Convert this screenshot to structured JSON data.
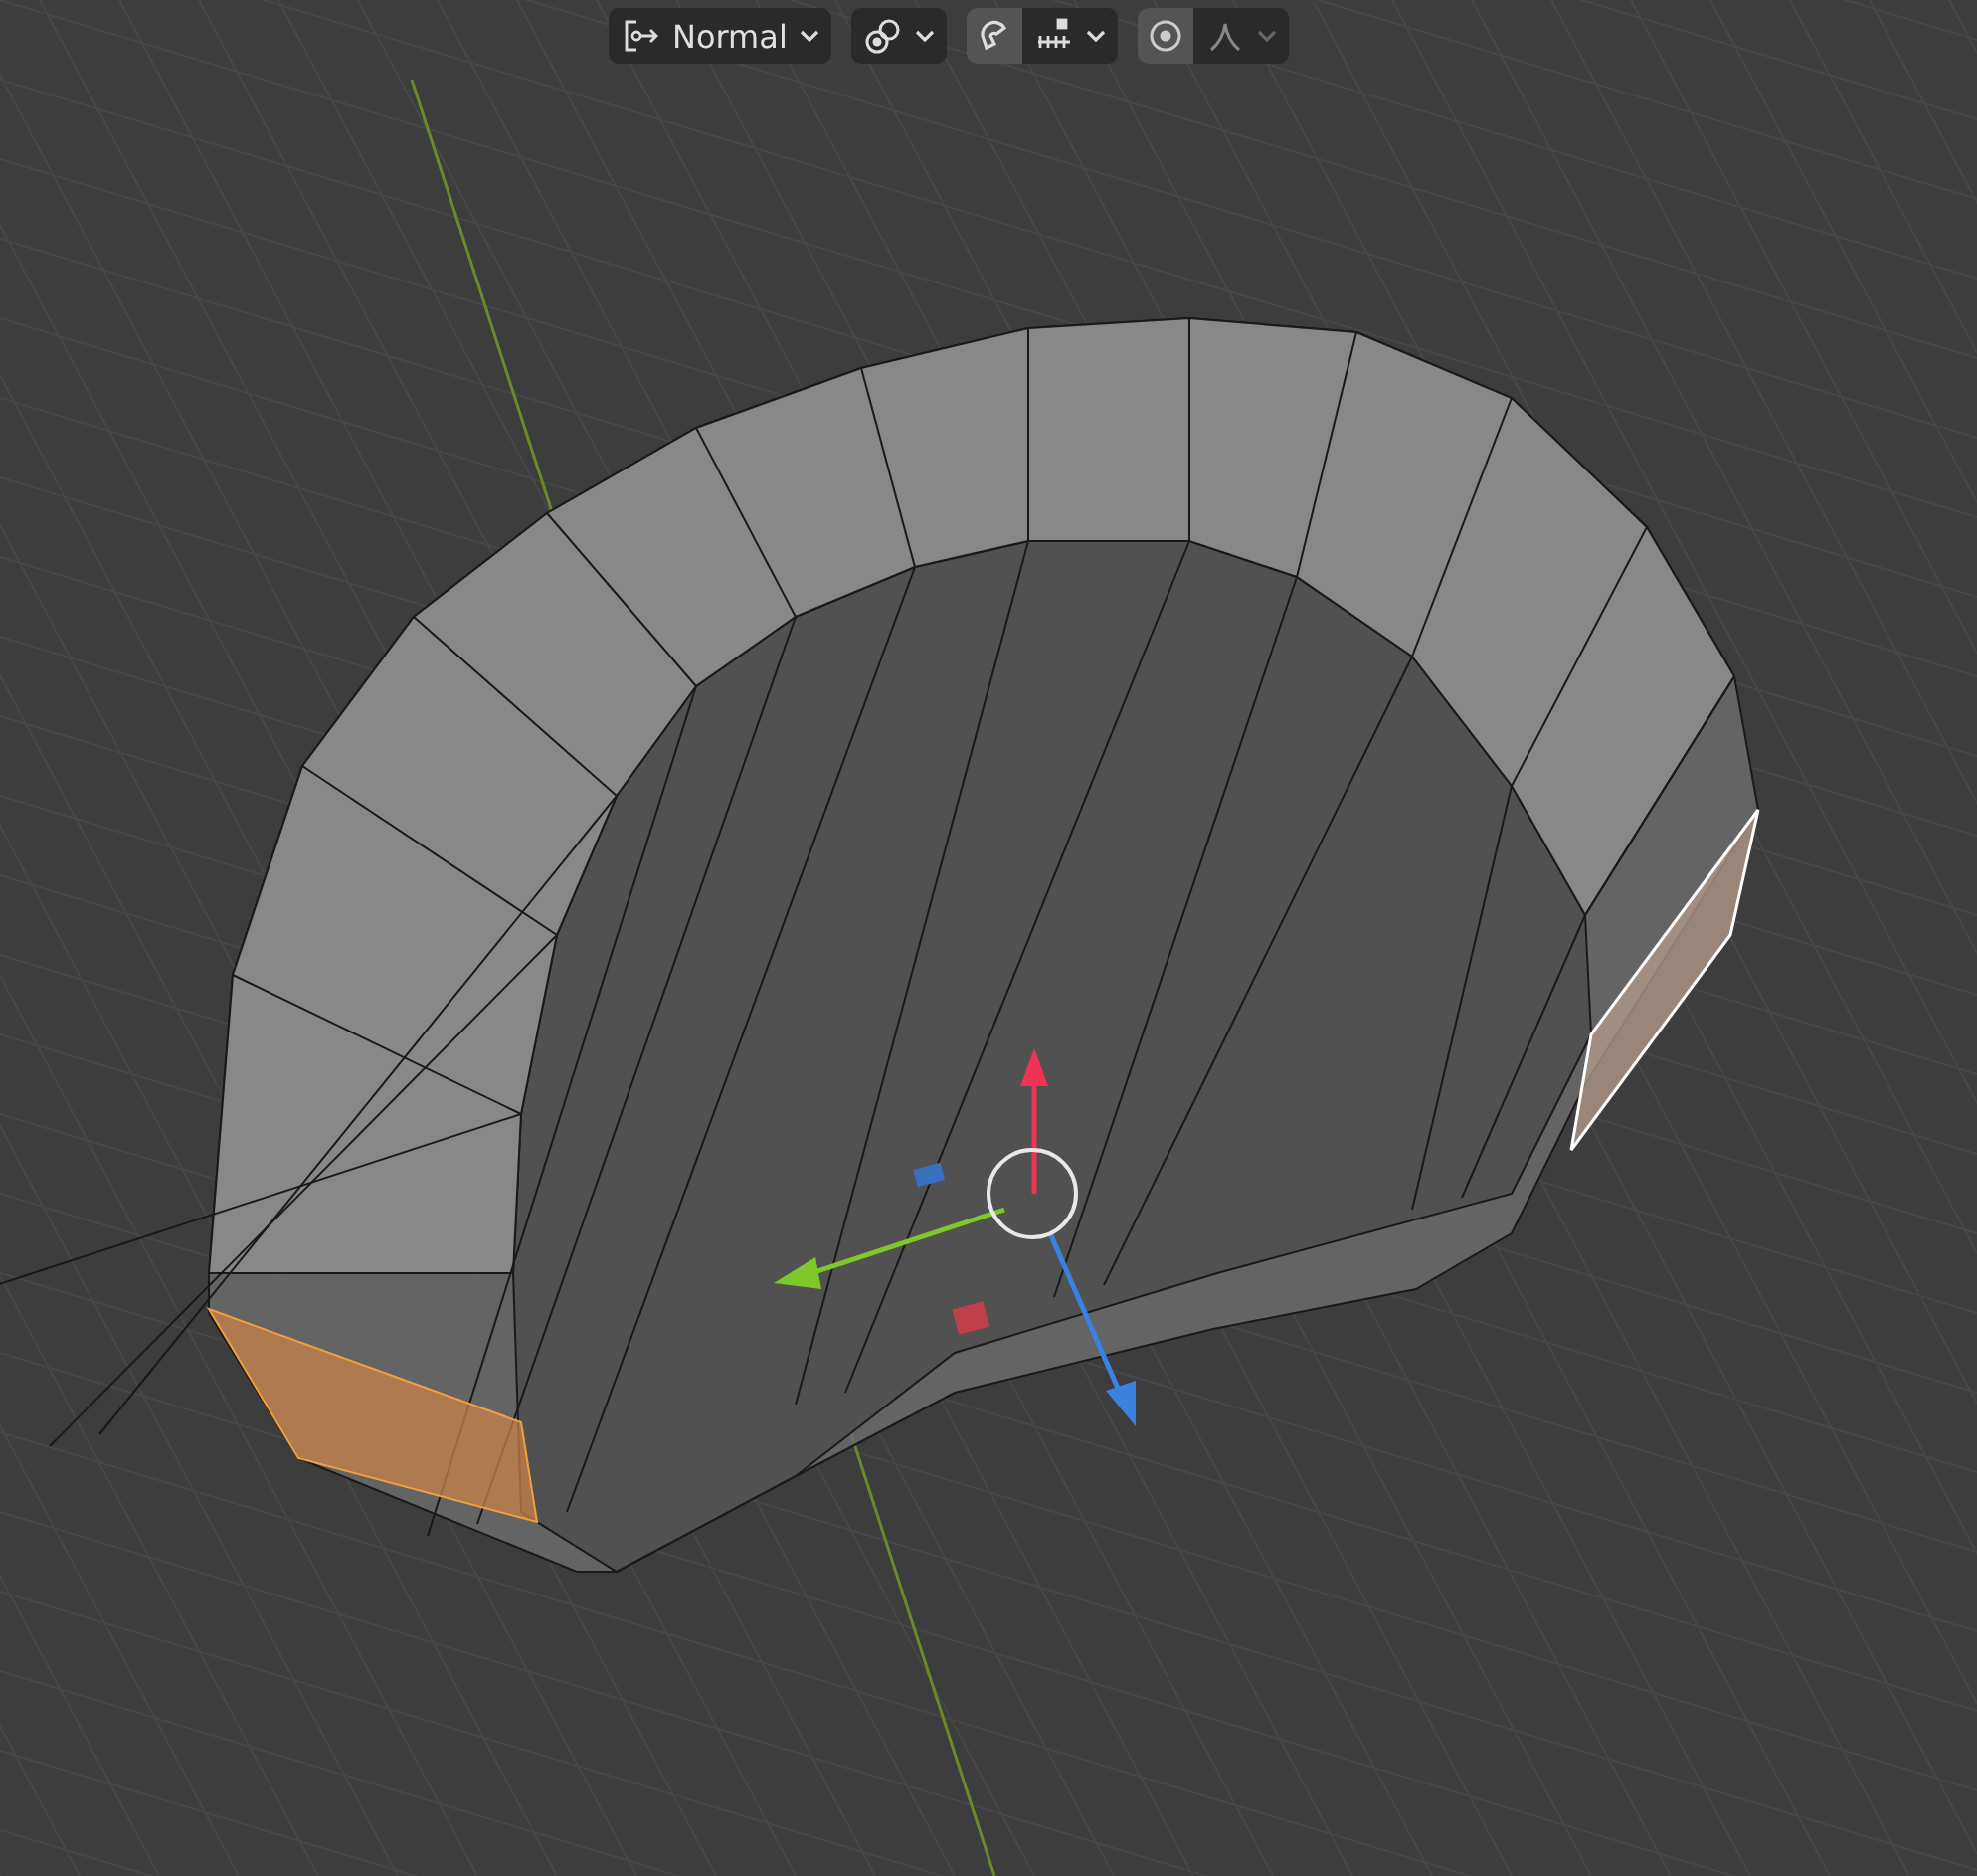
{
  "header": {
    "orientation": {
      "label": "Normal"
    },
    "snapping": {
      "on": true
    },
    "proportional_editing": {
      "on": true
    }
  }
}
